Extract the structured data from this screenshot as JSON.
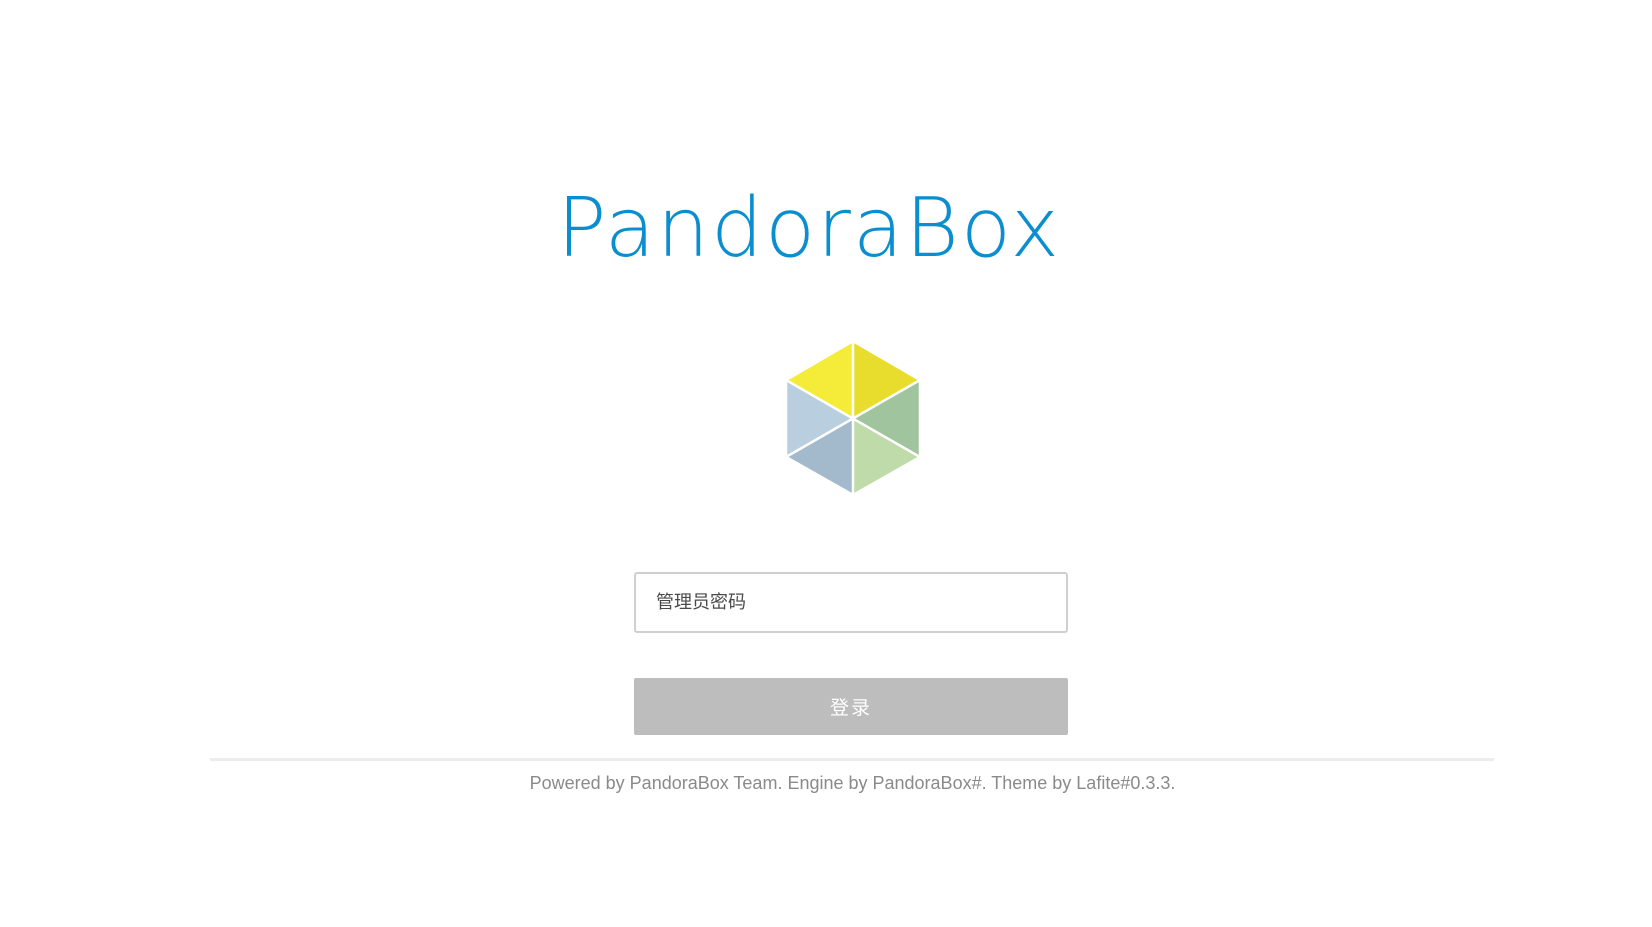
{
  "brand": {
    "name": "PandoraBox",
    "color": "#0a8ecf"
  },
  "logo": {
    "icon": "pandorabox-cube-icon",
    "colors": {
      "top_left": "#f5ec3a",
      "top_right": "#e8dc2c",
      "left_upper": "#b9cfe0",
      "left_lower": "#a3b9cc",
      "right_upper": "#a0c49e",
      "right_lower": "#bedba9"
    }
  },
  "login": {
    "password_placeholder": "管理员密码",
    "password_value": "",
    "submit_label": "登录",
    "submit_color": "#bdbdbd"
  },
  "footer": {
    "credits": "Powered by PandoraBox Team. Engine by PandoraBox#. Theme by Lafite#0.3.3."
  }
}
